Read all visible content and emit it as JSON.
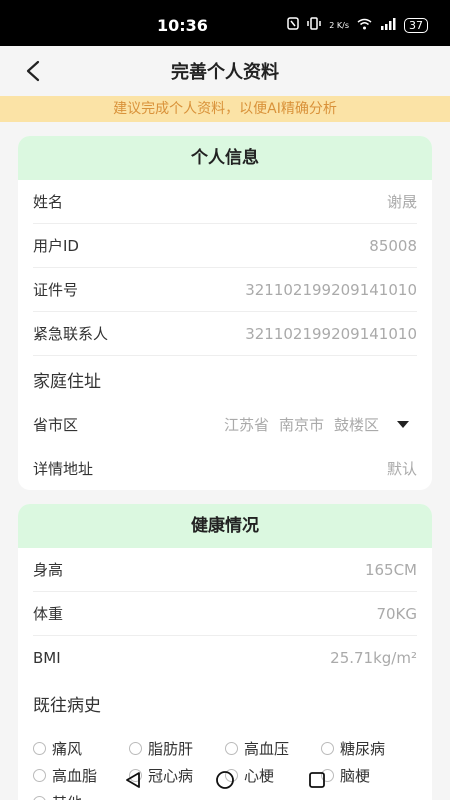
{
  "status_bar": {
    "time": "10:36",
    "network_speed": "2 K/s",
    "battery": "37"
  },
  "header": {
    "title": "完善个人资料"
  },
  "notice": "建议完成个人资料，以便AI精确分析",
  "personal_info": {
    "section_title": "个人信息",
    "fields": [
      {
        "label": "姓名",
        "value": "谢晟"
      },
      {
        "label": "用户ID",
        "value": "85008"
      },
      {
        "label": "证件号",
        "value": "321102199209141010"
      },
      {
        "label": "紧急联系人",
        "value": "321102199209141010"
      }
    ],
    "address_title": "家庭住址",
    "region_label": "省市区",
    "region": {
      "province": "江苏省",
      "city": "南京市",
      "district": "鼓楼区"
    },
    "detail_label": "详情地址",
    "detail_value": "默认"
  },
  "health": {
    "section_title": "健康情况",
    "fields": [
      {
        "label": "身高",
        "value": "165CM"
      },
      {
        "label": "体重",
        "value": "70KG"
      },
      {
        "label": "BMI",
        "value": "25.71kg/m²"
      }
    ],
    "history_title": "既往病史",
    "conditions": [
      "痛风",
      "脂肪肝",
      "高血压",
      "糖尿病",
      "高血脂",
      "冠心病",
      "心梗",
      "脑梗",
      "其他"
    ]
  },
  "icons": {
    "back": "chevron-left-icon",
    "dropdown": "caret-down-icon",
    "nav_back": "triangle-back-icon",
    "nav_home": "circle-home-icon",
    "nav_recent": "square-recent-icon"
  }
}
